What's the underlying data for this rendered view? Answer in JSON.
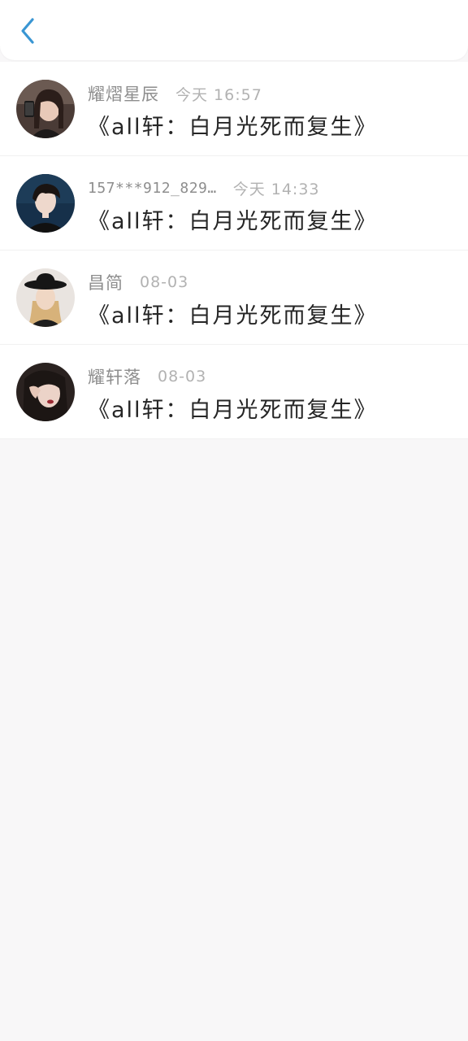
{
  "colors": {
    "accent": "#3a96d3",
    "name_text": "#8e8e8e",
    "time_text": "#b2b2b2",
    "title_text": "#262626",
    "background": "#f8f7f8"
  },
  "header": {
    "back_icon": "chevron-left-icon"
  },
  "items": [
    {
      "name": "耀熠星辰",
      "time": "今天 16:57",
      "title": "《all轩：白月光死而复生》"
    },
    {
      "name": "157***912_829…",
      "time": "今天 14:33",
      "title": "《all轩：白月光死而复生》"
    },
    {
      "name": "昌简",
      "time": "08-03",
      "title": "《all轩：白月光死而复生》"
    },
    {
      "name": "耀轩落",
      "time": "08-03",
      "title": "《all轩：白月光死而复生》"
    }
  ]
}
